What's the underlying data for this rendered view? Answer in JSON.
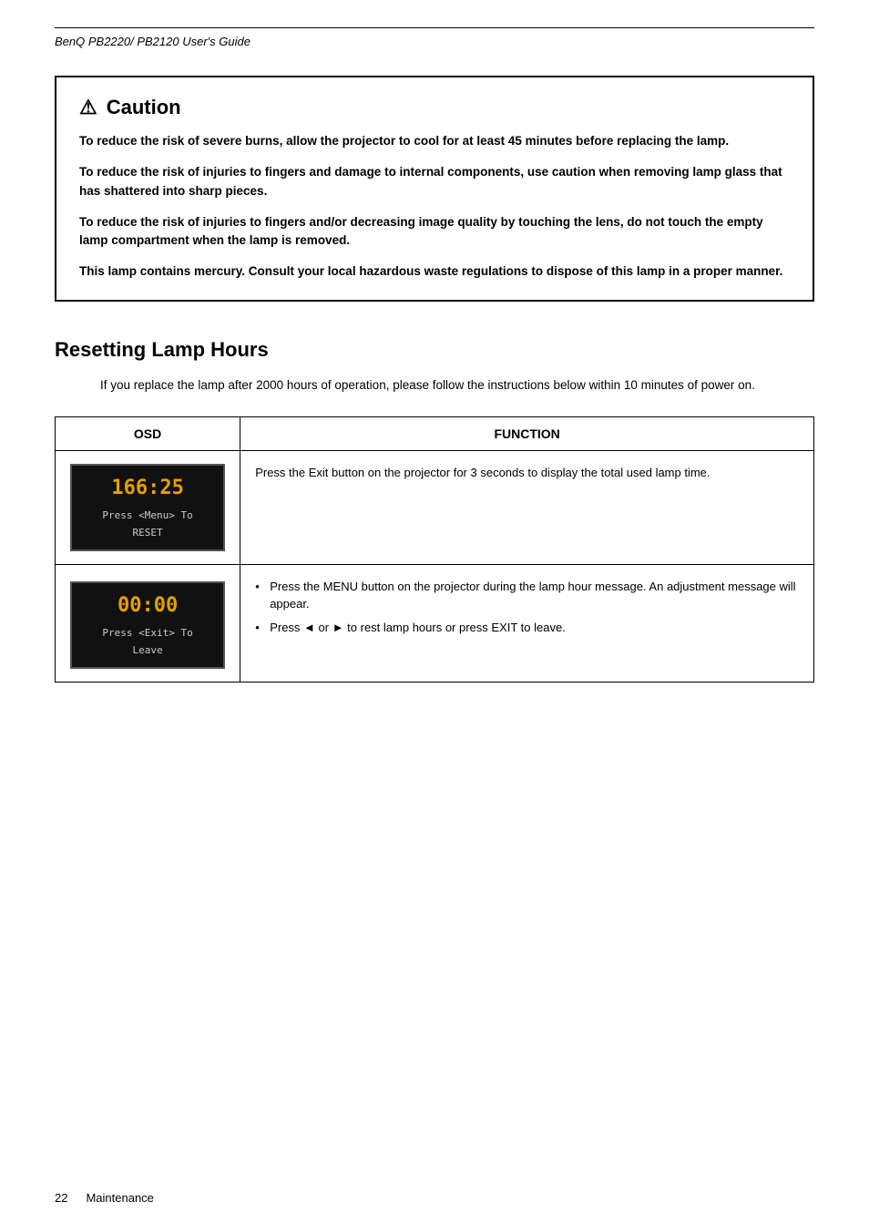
{
  "header": {
    "title": "BenQ PB2220/ PB2120 User's Guide"
  },
  "caution": {
    "heading": "Caution",
    "icon": "⚠",
    "paragraphs": [
      "To reduce the risk of severe burns, allow the projector to cool for at least 45 minutes before replacing the lamp.",
      "To reduce the risk of injuries to fingers and damage to internal components, use caution when removing lamp glass that has shattered into sharp pieces.",
      "To reduce the risk of injuries to fingers and/or decreasing image quality by touching the lens, do not touch the empty lamp compartment when the lamp is removed.",
      "This lamp contains mercury. Consult your local hazardous waste regulations to dispose of this lamp in a proper manner."
    ]
  },
  "section": {
    "title": "Resetting Lamp Hours",
    "intro": "If you replace the lamp after 2000 hours of operation, please follow the instructions below within 10 minutes of power on.",
    "table": {
      "col1_header": "OSD",
      "col2_header": "FUNCTION",
      "rows": [
        {
          "osd_time": "166:25",
          "osd_label": "Press <Menu>   To RESET",
          "function_text": "Press the Exit button on the projector for 3 seconds to display the total used lamp time.",
          "function_type": "plain"
        },
        {
          "osd_time": "00:00",
          "osd_label": "Press <Exit>   To Leave",
          "function_bullets": [
            "Press the MENU button on the projector during the lamp hour message. An adjustment message will appear.",
            "Press ◄ or ► to rest lamp hours or press EXIT to leave."
          ],
          "function_type": "bullets"
        }
      ]
    }
  },
  "footer": {
    "page_number": "22",
    "page_label": "Maintenance"
  }
}
